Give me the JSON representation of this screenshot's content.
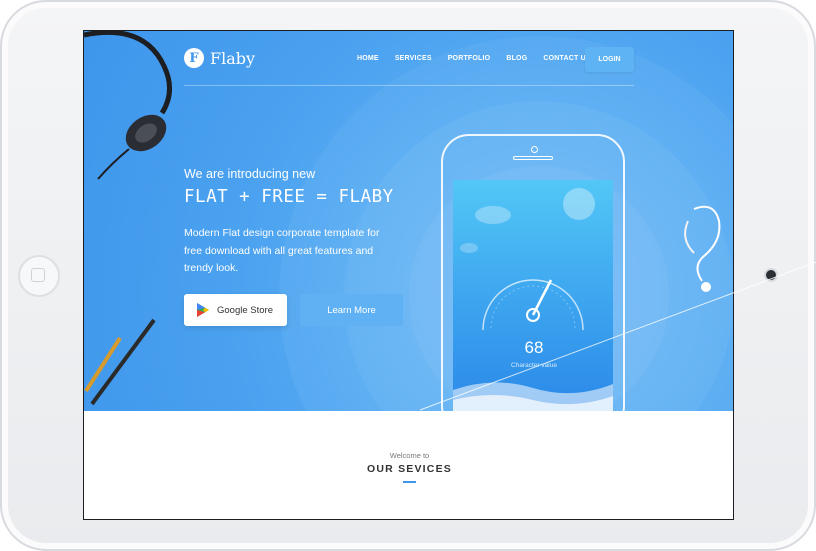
{
  "brand": {
    "mark": "F",
    "name": "Flaby"
  },
  "nav": {
    "items": [
      "HOME",
      "SERVICES",
      "PORTFOLIO",
      "BLOG",
      "CONTACT US"
    ],
    "login": "LOGIN"
  },
  "hero": {
    "intro": "We are introducing new",
    "headline": "FLAT + FREE = FLABY",
    "description": "Modern Flat design corporate template for free download with all great features and trendy look.",
    "store_button": "Google Store",
    "learn_button": "Learn More"
  },
  "phone": {
    "gauge_value": "68",
    "gauge_label": "Character value"
  },
  "services": {
    "welcome": "Welcome to",
    "title": "OUR SEVICES"
  },
  "colors": {
    "hero_blue": "#3e96ec",
    "button_blue": "#5fb1f3",
    "accent": "#3e96ec"
  },
  "icons": [
    "play-store-icon",
    "headphones-icon",
    "pencil-icon",
    "earphones-icon"
  ]
}
